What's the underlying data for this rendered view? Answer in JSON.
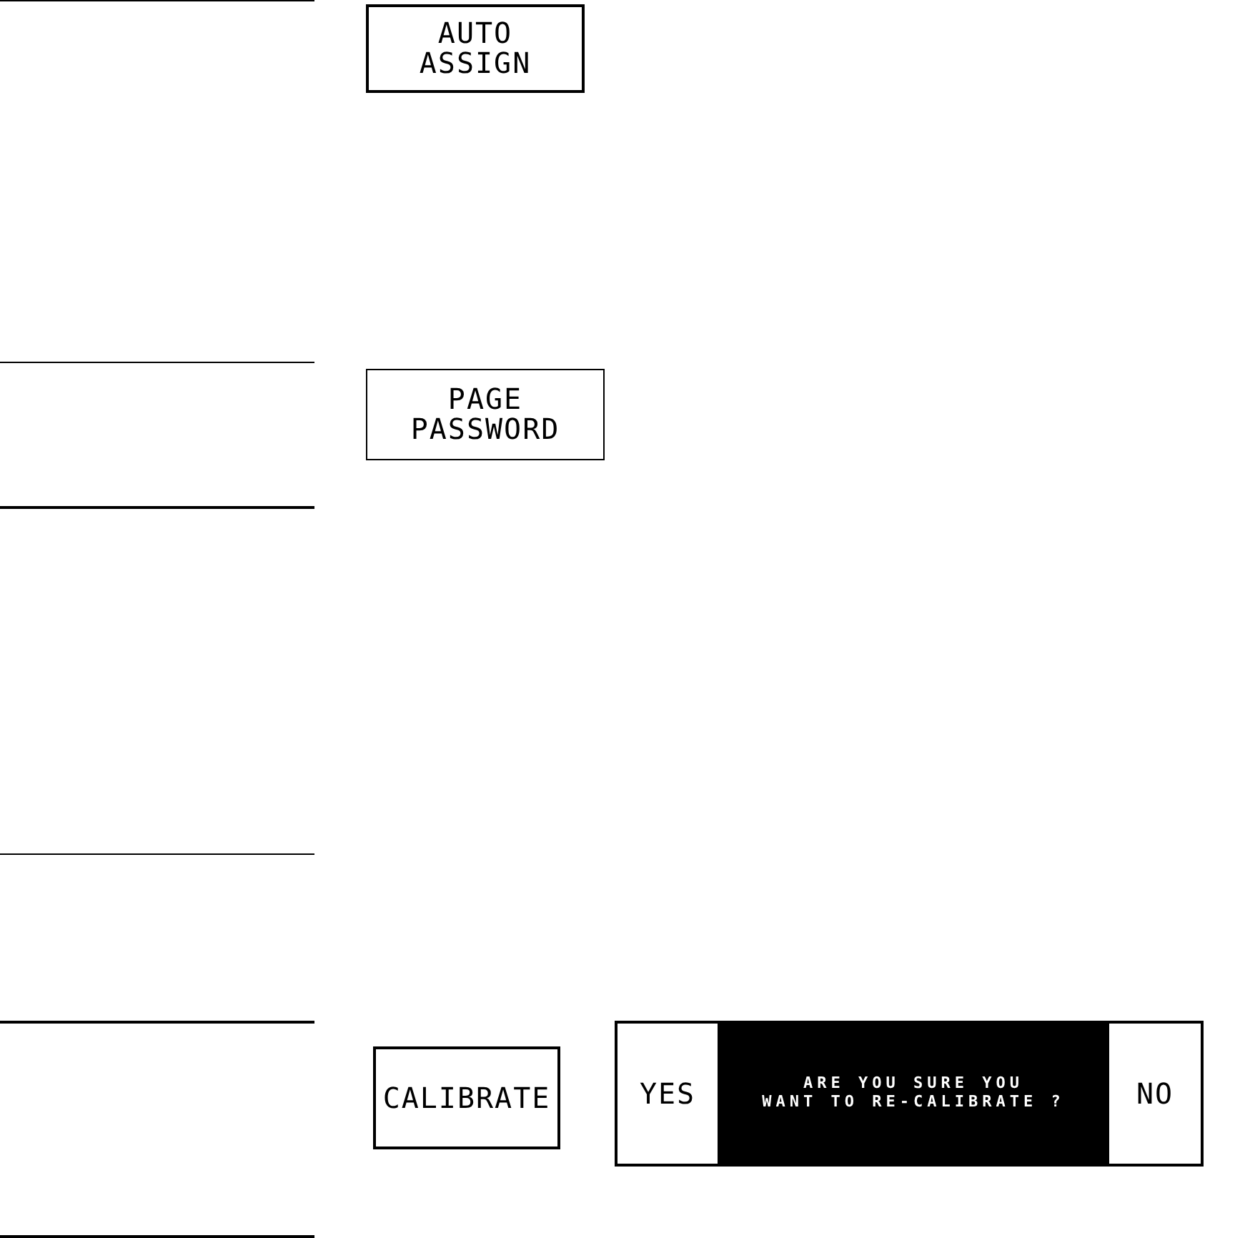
{
  "sections": [
    {
      "kind": "thin",
      "controls": [
        {
          "kind": "button",
          "label": "AUTO\nASSIGN"
        }
      ]
    },
    {
      "kind": "thin",
      "controls": [
        {
          "kind": "button",
          "label": "PAGE\nPASSWORD"
        }
      ]
    },
    {
      "kind": "thick"
    },
    {
      "kind": "thin"
    },
    {
      "kind": "thick",
      "controls": [
        {
          "kind": "button",
          "label": "CALIBRATE"
        },
        {
          "kind": "confirm",
          "yes": "YES",
          "message": "ARE YOU SURE YOU\nWANT TO RE-CALIBRATE ?",
          "no": "NO"
        }
      ]
    }
  ]
}
